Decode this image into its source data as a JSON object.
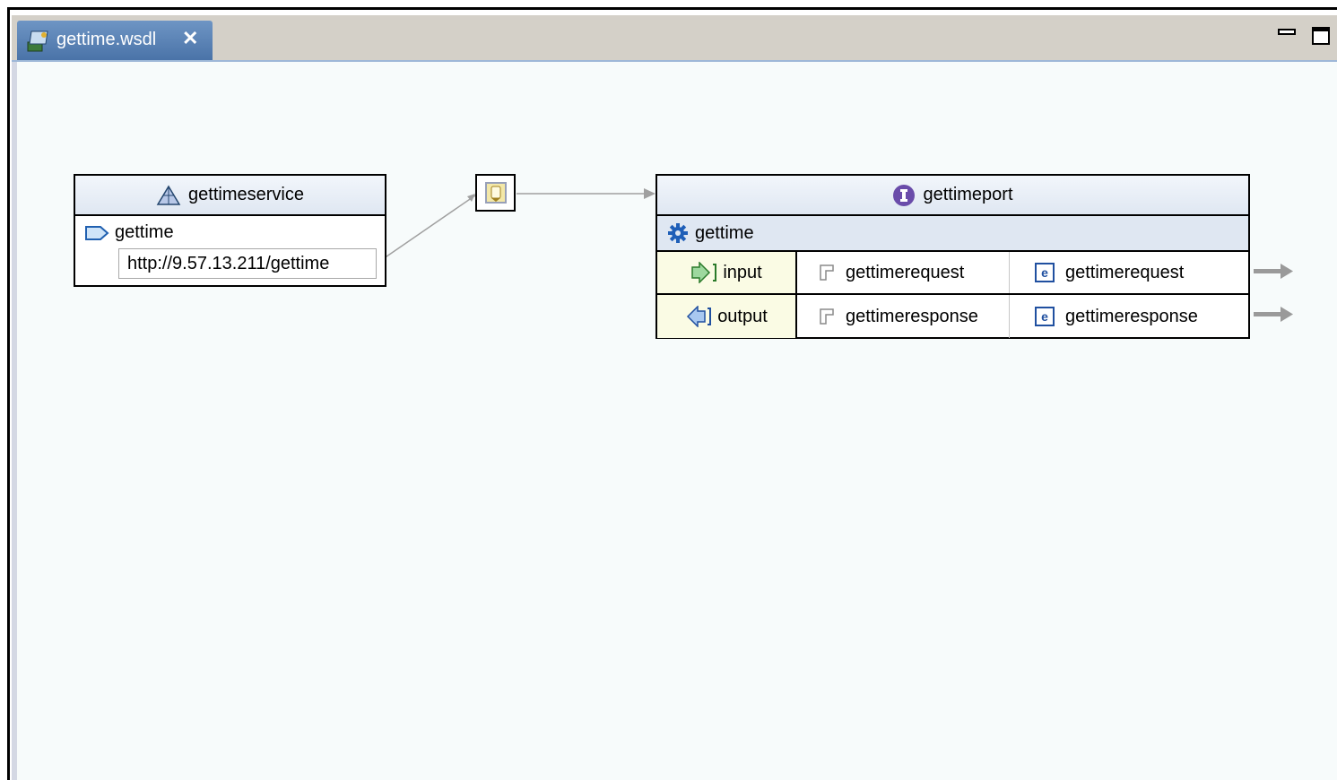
{
  "editor": {
    "tab_title": "gettime.wsdl",
    "tab_close": "✕",
    "tab_icon": "wsdl-file-icon"
  },
  "service": {
    "name": "gettimeservice",
    "icon": "service-icon",
    "port_name": "gettime",
    "port_icon": "port-icon",
    "address": "http://9.57.13.211/gettime"
  },
  "binding": {
    "icon": "binding-icon"
  },
  "porttype": {
    "name": "gettimeport",
    "icon": "interface-icon",
    "operation": "gettime",
    "operation_icon": "gear-icon",
    "messages": [
      {
        "direction": "input",
        "message": "gettimerequest",
        "element": "gettimerequest"
      },
      {
        "direction": "output",
        "message": "gettimeresponse",
        "element": "gettimeresponse"
      }
    ]
  },
  "colors": {
    "tab_active": "#5a82b6",
    "header_fill": "#dfe7f2",
    "direction_cell": "#fafbe4",
    "canvas": "#f7fbfb"
  }
}
